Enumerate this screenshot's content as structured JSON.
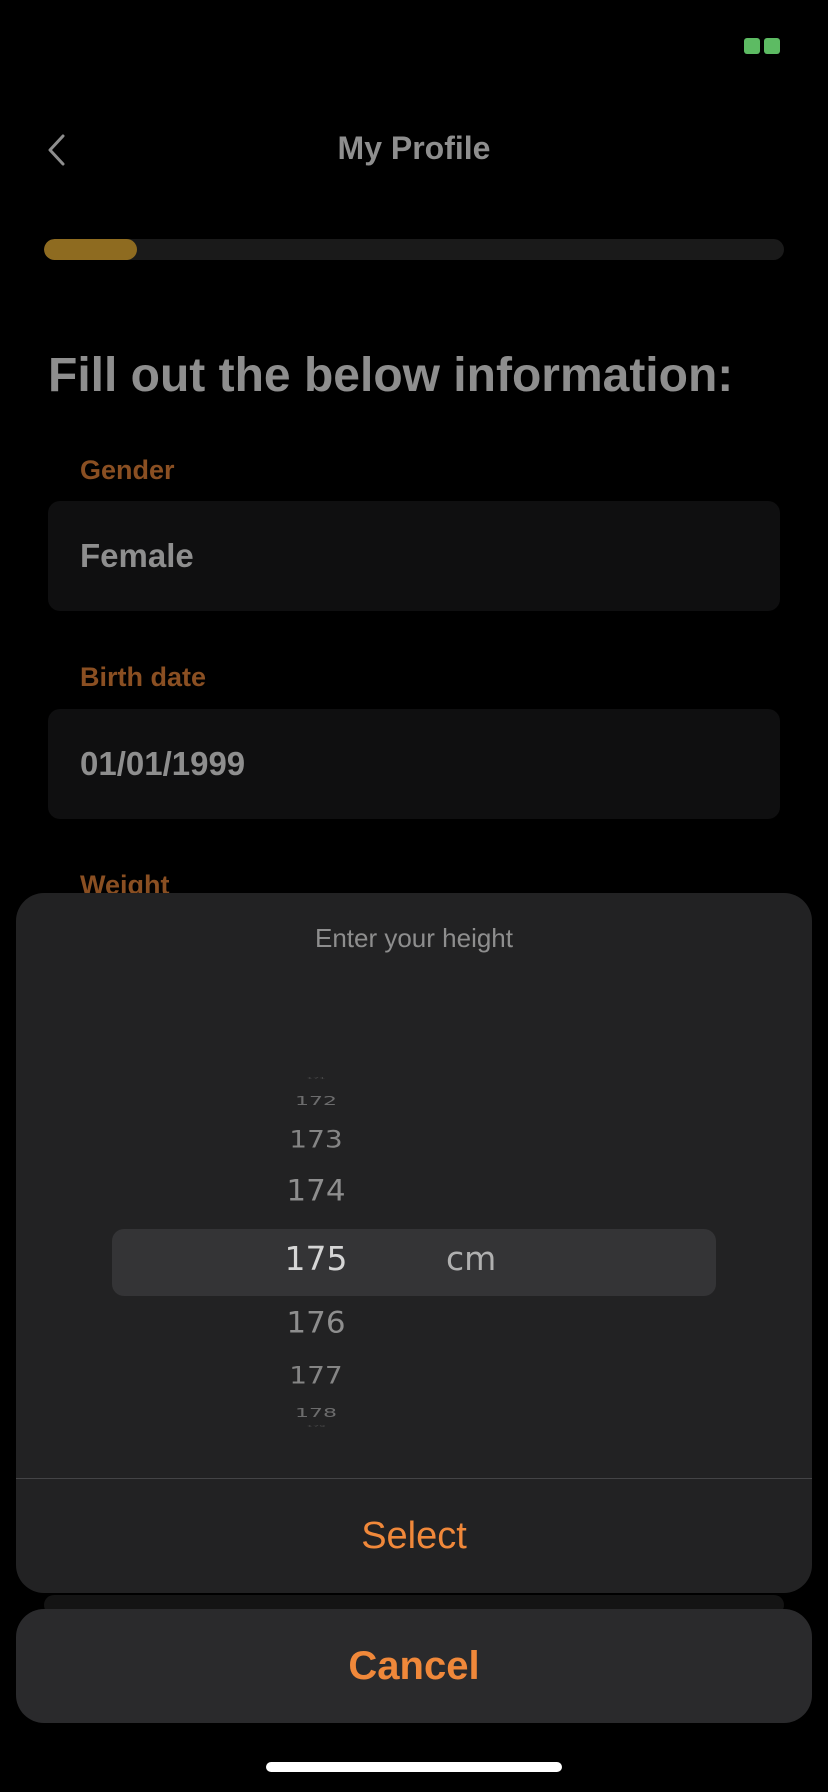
{
  "header": {
    "title": "My Profile",
    "back_icon": "chevron-left-icon"
  },
  "progress": {
    "fraction": 0.125,
    "color": "#8e6b20"
  },
  "form": {
    "heading": "Fill out the below information:",
    "gender": {
      "label": "Gender",
      "value": "Female"
    },
    "birth_date": {
      "label": "Birth date",
      "value": "01/01/1999"
    },
    "weight": {
      "label": "Weight"
    }
  },
  "height_picker": {
    "title": "Enter your height",
    "values": [
      "171",
      "172",
      "173",
      "174",
      "175",
      "176",
      "177",
      "178",
      "179"
    ],
    "selected": "175",
    "unit": "cm",
    "select_label": "Select"
  },
  "cancel_label": "Cancel",
  "colors": {
    "accent": "#f0883a",
    "label": "#8a4f22",
    "background": "#000000"
  }
}
